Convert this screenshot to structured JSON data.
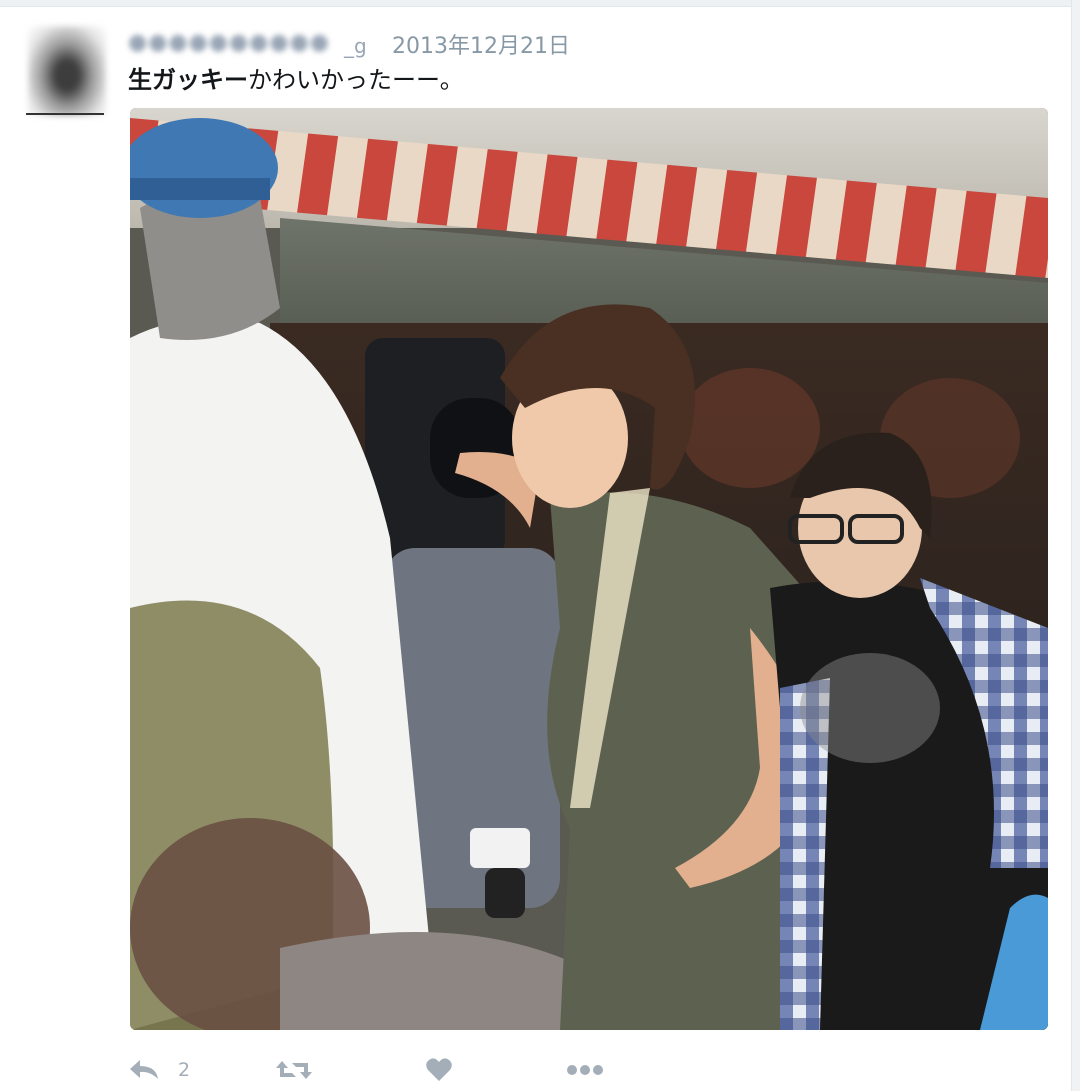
{
  "tweet": {
    "handle_tail": "_g",
    "timestamp": "2013年12月21日",
    "text_bold": "生ガッキー",
    "text_rest": "かわいかったーー。"
  },
  "actions": {
    "reply_count": "2",
    "icons": [
      "reply-icon",
      "retweet-icon",
      "like-icon",
      "more-icon"
    ]
  },
  "colors": {
    "meta_gray": "#8899a6",
    "icon_gray": "#a3aeb8",
    "text": "#14171a"
  }
}
